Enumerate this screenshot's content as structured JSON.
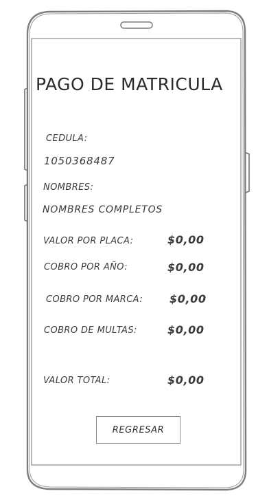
{
  "screen": {
    "title": "PAGO DE MATRICULA"
  },
  "form": {
    "cedula_label": "CEDULA:",
    "cedula_value": "1050368487",
    "nombres_label": "NOMBRES:",
    "nombres_value": "NOMBRES COMPLETOS"
  },
  "charges": [
    {
      "label": "VALOR POR PLACA:",
      "amount": "$0,00"
    },
    {
      "label": "COBRO POR AÑO:",
      "amount": "$0,00"
    },
    {
      "label": "COBRO POR MARCA:",
      "amount": "$0,00"
    },
    {
      "label": "COBRO DE MULTAS:",
      "amount": "$0,00"
    }
  ],
  "total": {
    "label": "VALOR TOTAL:",
    "amount": "$0,00"
  },
  "actions": {
    "back_label": "REGRESAR"
  }
}
